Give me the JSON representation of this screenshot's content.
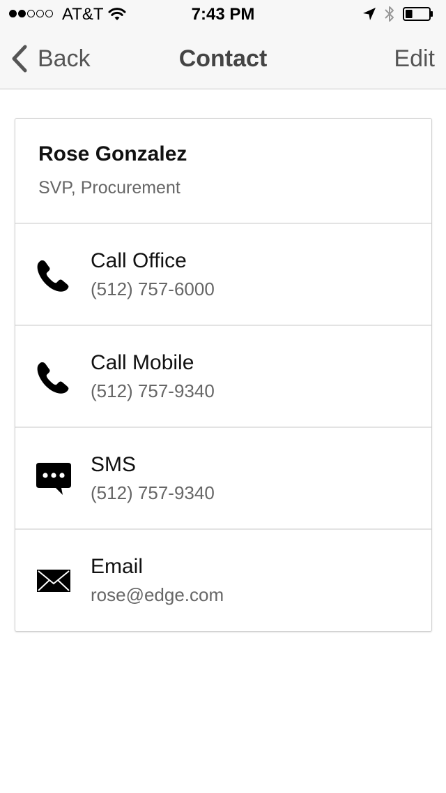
{
  "status_bar": {
    "signal_dots_filled": 2,
    "signal_dots_total": 5,
    "carrier": "AT&T",
    "time": "7:43 PM",
    "icons": [
      "wifi-icon",
      "location-arrow-icon",
      "bluetooth-icon",
      "battery-icon"
    ],
    "battery_level": 0.3
  },
  "nav": {
    "back_label": "Back",
    "title": "Contact",
    "edit_label": "Edit"
  },
  "contact": {
    "name": "Rose Gonzalez",
    "title": "SVP, Procurement"
  },
  "actions": [
    {
      "icon": "phone-icon",
      "label": "Call Office",
      "value": "(512) 757-6000"
    },
    {
      "icon": "phone-icon",
      "label": "Call Mobile",
      "value": "(512) 757-9340"
    },
    {
      "icon": "chat-bubble-icon",
      "label": "SMS",
      "value": "(512) 757-9340"
    },
    {
      "icon": "envelope-icon",
      "label": "Email",
      "value": "rose@edge.com"
    }
  ],
  "colors": {
    "nav_background": "#f7f7f7",
    "nav_text": "#555555",
    "secondary_text": "#666666",
    "divider": "#e3e3e3"
  }
}
